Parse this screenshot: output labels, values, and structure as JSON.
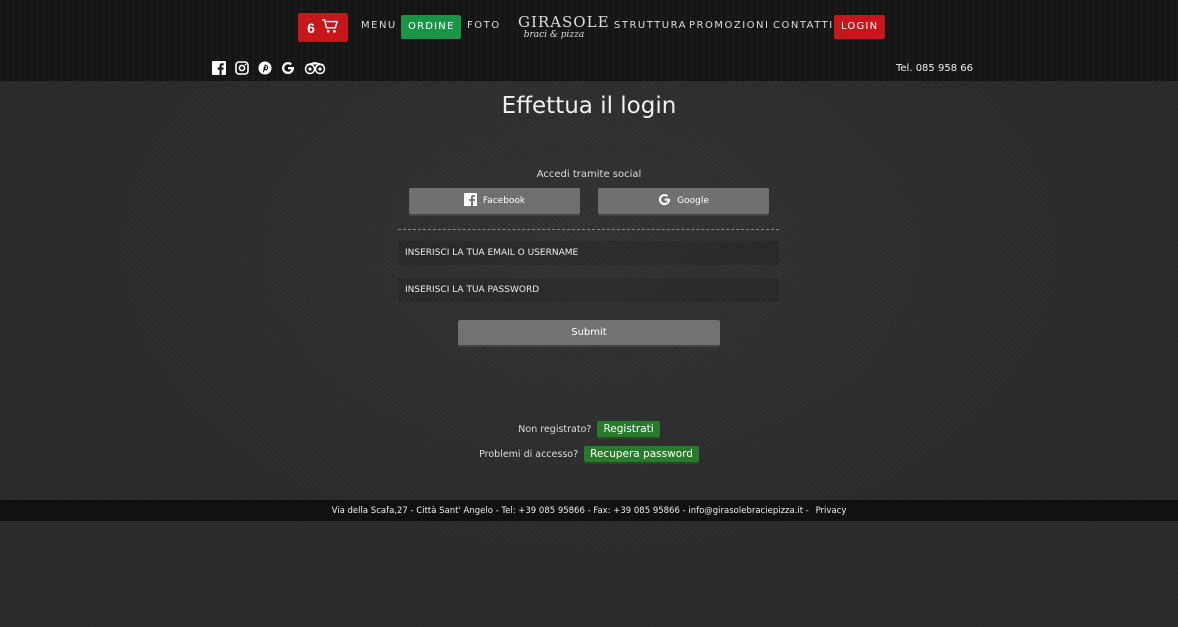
{
  "header": {
    "cart_count": "6",
    "nav": {
      "menu": "MENU",
      "ordine": "ORDINE",
      "foto": "FOTO",
      "struttura": "STRUTTURA",
      "promozioni": "PROMOZIONI",
      "contatti": "CONTATTI",
      "login": "LOGIN"
    },
    "logo": {
      "line1": "GIRASOLE",
      "line2": "braci & pizza"
    },
    "phone": "Tel. 085 958 66",
    "social_icons": [
      "facebook-icon",
      "instagram-icon",
      "pinterest-icon",
      "google-icon",
      "tripadvisor-icon"
    ],
    "colors": {
      "cart_bg": "#c8161d",
      "ordine_bg": "#1a9447",
      "login_bg": "#c8161d"
    }
  },
  "main": {
    "title": "Effettua il login",
    "social_label": "Accedi tramite social",
    "facebook_label": "Facebook",
    "google_label": "Google",
    "email_placeholder": "INSERISCI LA TUA EMAIL O USERNAME",
    "password_placeholder": "INSERISCI LA TUA PASSWORD",
    "submit_label": "Submit",
    "not_registered": "Non registrato?",
    "register_label": "Registrati",
    "access_problems": "Problemi di accesso?",
    "recover_label": "Recupera password"
  },
  "footer": {
    "text": "Via della Scafa,27 - Città Sant' Angelo - Tel: +39 085 95866 - Fax: +39 085 95866 - info@girasolebraciepizza.it - ",
    "privacy": "Privacy"
  }
}
